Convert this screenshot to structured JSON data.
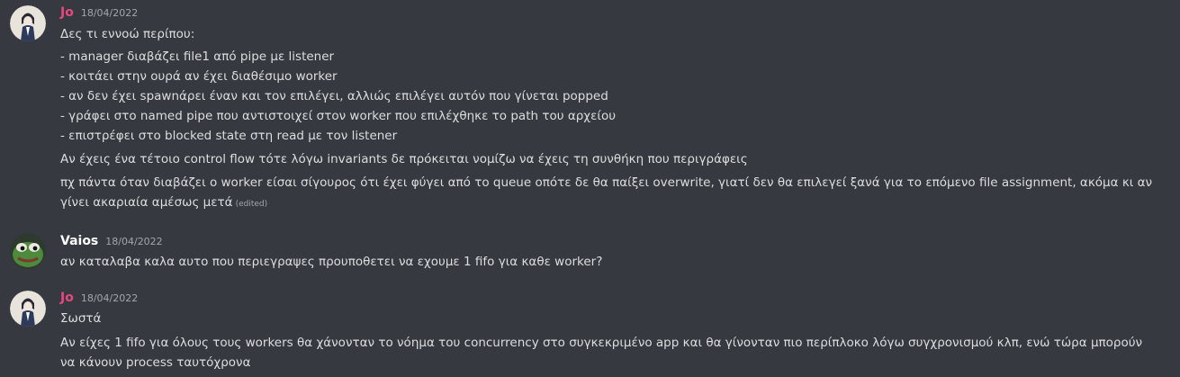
{
  "colors": {
    "background": "#36393f",
    "text": "#dcddde",
    "muted": "#a3a6aa",
    "jo_name": "#e7487f",
    "vaios_name": "#ffffff"
  },
  "messages": [
    {
      "author": "Jo",
      "timestamp": "18/04/2022",
      "avatar": "anime-character-avatar",
      "lines": [
        "Δες τι εννοώ περίπου:",
        "- manager διαβάζει file1 από pipe με listener",
        "- κοιτάει στην ουρά αν έχει διαθέσιμο worker",
        "- αν δεν έχει spawnάρει έναν και τον επιλέγει, αλλιώς επιλέγει αυτόν που γίνεται popped",
        "- γράφει στο named pipe που αντιστοιχεί στον worker που επιλέχθηκε το path του αρχείου",
        "- επιστρέφει στο blocked state στη read με τον listener",
        "Αν έχεις ένα τέτοιο control flow τότε λόγω invariants δε πρόκειται νομίζω να έχεις τη συνθήκη που περιγράφεις",
        "πχ πάντα όταν διαβάζει ο worker είσαι σίγουρος ότι έχει φύγει από το queue οπότε δε θα παίξει overwrite, γιατί δεν θα επιλεγεί ξανά για το επόμενο file assignment, ακόμα κι αν γίνει ακαριαία αμέσως μετά"
      ],
      "edited_label": "(edited)"
    },
    {
      "author": "Vaios",
      "timestamp": "18/04/2022",
      "avatar": "frog-avatar",
      "lines": [
        "αν καταλαβα καλα αυτο που περιεγραψες προυποθετει να εχουμε 1 fifo για καθε worker?"
      ]
    },
    {
      "author": "Jo",
      "timestamp": "18/04/2022",
      "avatar": "anime-character-avatar",
      "lines": [
        "Σωστά",
        "Αν είχες 1 fifo για όλους τους workers θα χάνονταν το νόημα του concurrency στο συγκεκριμένο app και θα γίνονταν πιο περίπλοκο λόγω συγχρονισμού κλπ, ενώ τώρα μπορούν να κάνουν process ταυτόχρονα"
      ]
    }
  ]
}
